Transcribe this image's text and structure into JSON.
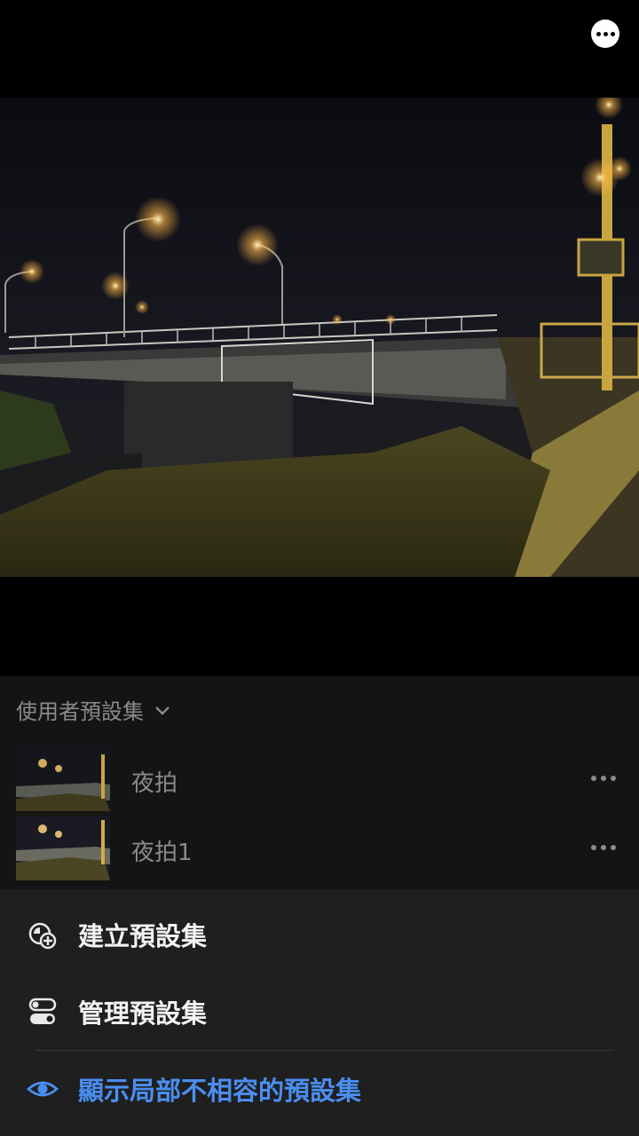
{
  "header": {
    "more_icon": "ellipsis-circle-icon"
  },
  "photo": {
    "subject": "night-bridge-photo"
  },
  "presets": {
    "group_title": "使用者預設集",
    "group_chevron_icon": "chevron-down-icon",
    "items": [
      {
        "label": "夜拍",
        "more_icon": "ellipsis-icon"
      },
      {
        "label": "夜拍1",
        "more_icon": "ellipsis-icon"
      }
    ]
  },
  "action_sheet": {
    "create": {
      "label": "建立預設集",
      "icon": "create-preset-icon"
    },
    "manage": {
      "label": "管理預設集",
      "icon": "toggle-manage-icon"
    },
    "show_incompatible": {
      "label": "顯示局部不相容的預設集",
      "icon": "eye-icon"
    }
  },
  "colors": {
    "accent_blue": "#4a8ef0",
    "panel_bg": "#141414",
    "sheet_bg": "#1f1f1f",
    "muted_text": "#8a8a8a"
  }
}
